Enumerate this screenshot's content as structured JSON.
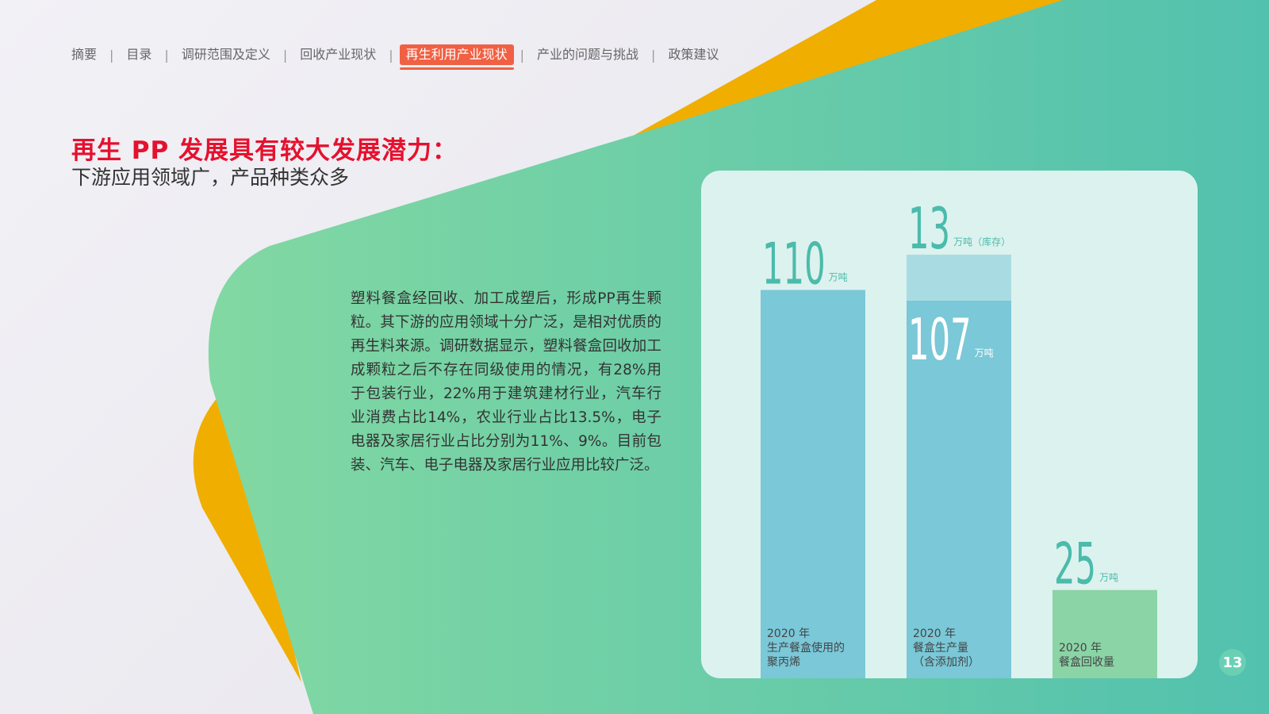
{
  "nav": {
    "items": [
      "摘要",
      "目录",
      "调研范围及定义",
      "回收产业现状",
      "再生利用产业现状",
      "产业的问题与挑战",
      "政策建议"
    ],
    "active_index": 4
  },
  "heading": {
    "title": "再生 PP 发展具有较大发展潜力：",
    "subtitle": "下游应用领域广，产品种类众多"
  },
  "body_text": "塑料餐盒经回收、加工成塑后，形成PP再生颗粒。其下游的应用领域十分广泛，是相对优质的再生料来源。调研数据显示，塑料餐盒回收加工成颗粒之后不存在同级使用的情况，有28%用于包装行业，22%用于建筑建材行业，汽车行业消费占比14%，农业行业占比13.5%，电子电器及家居行业占比分别为11%、9%。目前包装、汽车、电子电器及家居行业应用比较广泛。",
  "page_number": "13",
  "colors": {
    "accent_red": "#e5112e",
    "nav_active": "#f06043",
    "bar_blue": "#7ac8d8",
    "bar_light": "#a8dce2",
    "bar_green": "#8ad4a6",
    "number_teal": "#4bbbab"
  },
  "chart_data": {
    "type": "bar",
    "unit": "万吨",
    "ylim": [
      0,
      125
    ],
    "bars": [
      {
        "label_lines": [
          "2020 年",
          "生产餐盒使用的",
          "聚丙烯"
        ],
        "segments": [
          {
            "value": 110,
            "value_text": "110",
            "unit_text": "万吨"
          }
        ]
      },
      {
        "label_lines": [
          "2020 年",
          "餐盒生产量",
          "（含添加剂）"
        ],
        "segments": [
          {
            "value": 107,
            "value_text": "107",
            "unit_text": "万吨"
          },
          {
            "value": 13,
            "value_text": "13",
            "unit_text": "万吨（库存）"
          }
        ]
      },
      {
        "label_lines": [
          "2020 年",
          "餐盒回收量"
        ],
        "segments": [
          {
            "value": 25,
            "value_text": "25",
            "unit_text": "万吨"
          }
        ]
      }
    ]
  }
}
